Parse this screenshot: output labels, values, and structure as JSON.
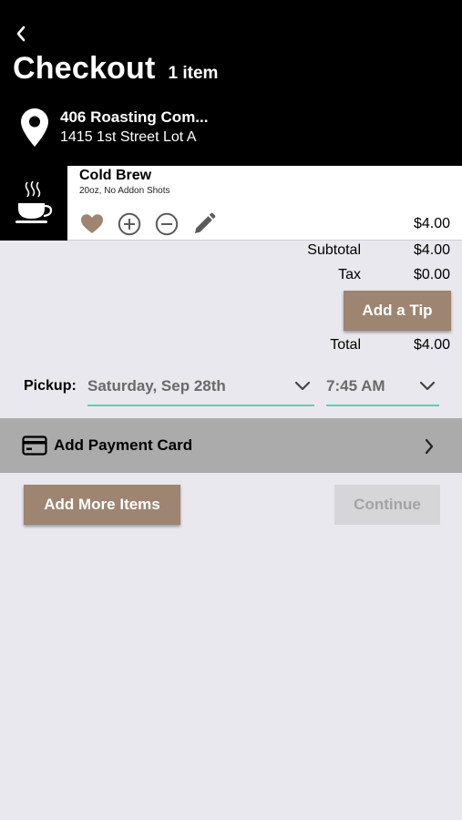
{
  "header": {
    "back_icon": "chevron-left-icon",
    "title": "Checkout",
    "item_count": "1 item",
    "location_icon": "map-pin-icon",
    "store_name": "406 Roasting Com...",
    "store_address": "1415 1st Street Lot A"
  },
  "cart": {
    "items": [
      {
        "name": "Cold Brew",
        "options": "20oz, No Addon Shots",
        "price": "$4.00",
        "thumbnail_icon": "coffee-cup-icon",
        "actions": [
          "heart-icon",
          "plus-circle-icon",
          "minus-circle-icon",
          "pencil-icon"
        ]
      }
    ]
  },
  "summary": {
    "subtotal_label": "Subtotal",
    "subtotal_value": "$4.00",
    "tax_label": "Tax",
    "tax_value": "$0.00",
    "tip_button": "Add a Tip",
    "total_label": "Total",
    "total_value": "$4.00"
  },
  "pickup": {
    "label": "Pickup:",
    "date": "Saturday, Sep 28th",
    "time": "7:45 AM"
  },
  "payment": {
    "icon": "credit-card-icon",
    "label": "Add Payment Card"
  },
  "buttons": {
    "add_more": "Add More Items",
    "continue": "Continue"
  },
  "colors": {
    "header_bg": "#000000",
    "accent_brown": "#9e8572",
    "underline_teal": "#5fcfb4",
    "payment_bg": "#ababab",
    "page_bg": "#e9e8ee",
    "disabled_bg": "#d6d6d8"
  }
}
